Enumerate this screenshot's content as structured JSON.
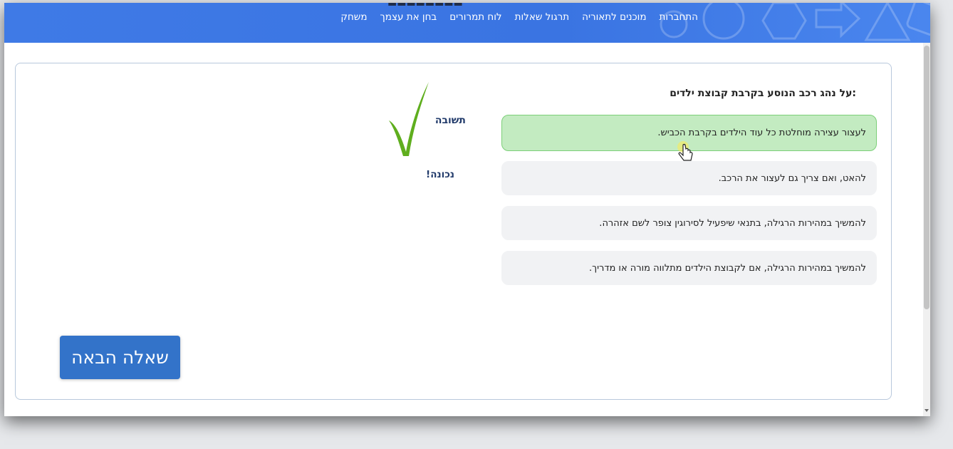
{
  "header": {
    "nav": [
      "משחק",
      "בחן את עצמך",
      "לוח תמרורים",
      "תרגול שאלות",
      "מוכנים לתאוריה",
      "התחברות"
    ]
  },
  "quiz": {
    "question": ":על נהג רכב הנוסע בקרבת קבוצת ילדים",
    "answers": [
      ".לעצור עצירה מוחלטת כל עוד הילדים בקרבת הכביש",
      ".להאט, ואם צריך גם לעצור את הרכב",
      ".להמשיך במהירות הרגילה, בתנאי שיפעיל לסירוגין צופר לשם אזהרה",
      ".להמשיך במהירות הרגילה, אם לקבוצת הילדים מתלווה מורה או מדריך"
    ],
    "selected_answer_index": 0,
    "result_label": "תשובה",
    "result_status": "!נכונה",
    "next_button": "שאלה הבאה"
  },
  "colors": {
    "header": "#3f7ae6",
    "correct_bg": "#c3ebc1",
    "correct_border": "#7ccf78",
    "button": "#3373c9",
    "checkmark": "#5fae1e"
  }
}
